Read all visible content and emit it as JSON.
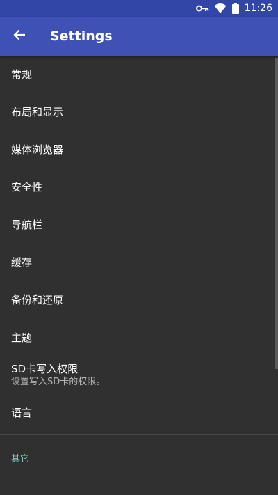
{
  "status_bar": {
    "time": "11:26",
    "icons": [
      "key-icon",
      "wifi-icon",
      "battery-icon"
    ]
  },
  "app_bar": {
    "title": "Settings",
    "back_icon": "arrow-back-icon",
    "color": "#3f51b5"
  },
  "preferences": {
    "general": "常规",
    "layout": "布局和显示",
    "media_browser": "媒体浏览器",
    "security": "安全性",
    "navbar": "导航栏",
    "cache": "缓存",
    "backup": "备份和还原",
    "theme": "主题",
    "sd_write_title": "SD卡写入权限",
    "sd_write_summary": "设置写入SD卡的权限。",
    "language": "语言"
  },
  "other_category": {
    "title": "其它",
    "accent_color": "#80cbc4"
  }
}
